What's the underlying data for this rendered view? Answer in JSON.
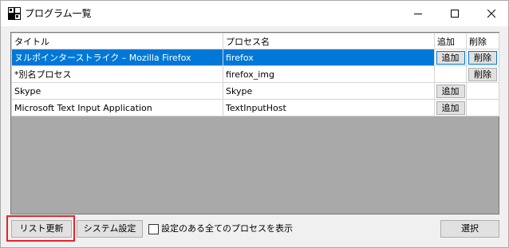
{
  "window": {
    "title": "プログラム一覧",
    "icon": "app-grid-icon"
  },
  "controls": {
    "minimize_icon": "minimize-icon",
    "maximize_icon": "maximize-icon",
    "close_icon": "close-icon"
  },
  "list": {
    "columns": [
      "タイトル",
      "プロセス名",
      "追加",
      "削除"
    ],
    "rows": [
      {
        "title": "ヌルポインターストライク – Mozilla Firefox",
        "process": "firefox",
        "add": "追加",
        "delete": "削除",
        "selected": true
      },
      {
        "title": "*別名プロセス",
        "process": "firefox_img",
        "add": "",
        "delete": "削除",
        "selected": false
      },
      {
        "title": "Skype",
        "process": "Skype",
        "add": "追加",
        "delete": "",
        "selected": false
      },
      {
        "title": "Microsoft Text Input Application",
        "process": "TextInputHost",
        "add": "追加",
        "delete": "",
        "selected": false
      }
    ]
  },
  "footer": {
    "refresh_label": "リスト更新",
    "system_settings_label": "システム設定",
    "show_all_label": "設定のある全てのプロセスを表示",
    "show_all_checked": false,
    "select_label": "選択"
  },
  "colors": {
    "selection": "#0078d7",
    "highlight": "#e8222a"
  }
}
